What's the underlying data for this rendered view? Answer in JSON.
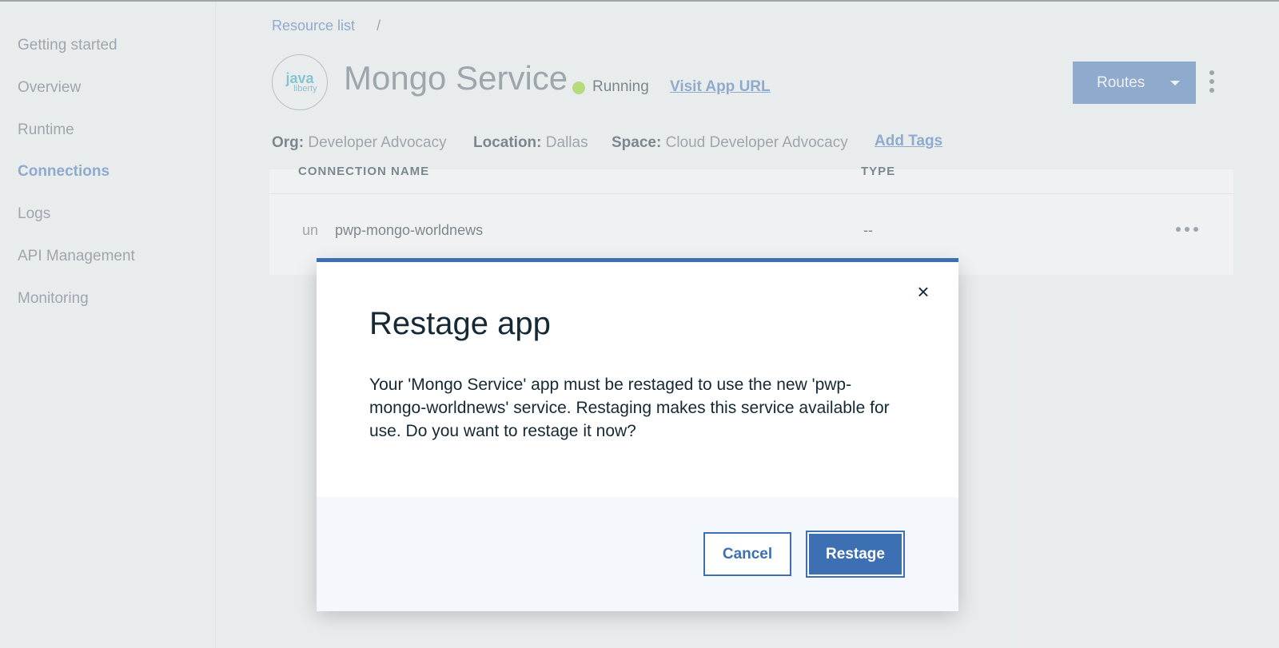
{
  "sidebar": {
    "items": [
      {
        "label": "Getting started"
      },
      {
        "label": "Overview"
      },
      {
        "label": "Runtime"
      },
      {
        "label": "Connections",
        "active": true
      },
      {
        "label": "Logs"
      },
      {
        "label": "API Management"
      },
      {
        "label": "Monitoring"
      }
    ]
  },
  "header": {
    "breadcrumb": {
      "link": "Resource list",
      "separator": "/"
    },
    "logo": {
      "line1": "java",
      "line2": "liberty"
    },
    "app_name": "Mongo Service",
    "status": "Running",
    "visit_link": "Visit App URL",
    "routes_label": "Routes",
    "meta": {
      "org_label": "Org:",
      "org_value": "Developer Advocacy",
      "location_label": "Location:",
      "location_value": "Dallas",
      "space_label": "Space:",
      "space_value": "Cloud Developer Advocacy"
    },
    "add_tags": "Add Tags"
  },
  "table": {
    "columns": [
      "CONNECTION NAME",
      "TYPE"
    ],
    "rows": [
      {
        "prefix": "un",
        "name": "pwp-mongo-worldnews",
        "type": "--"
      }
    ]
  },
  "modal": {
    "title": "Restage app",
    "body": "Your 'Mongo Service' app must be restaged to use the new 'pwp-mongo-worldnews' service. Restaging makes this service available for use. Do you want to restage it now?",
    "close": "×",
    "cancel_label": "Cancel",
    "confirm_label": "Restage"
  },
  "colors": {
    "accent": "#3d70b2",
    "status_running": "#8cd211"
  }
}
